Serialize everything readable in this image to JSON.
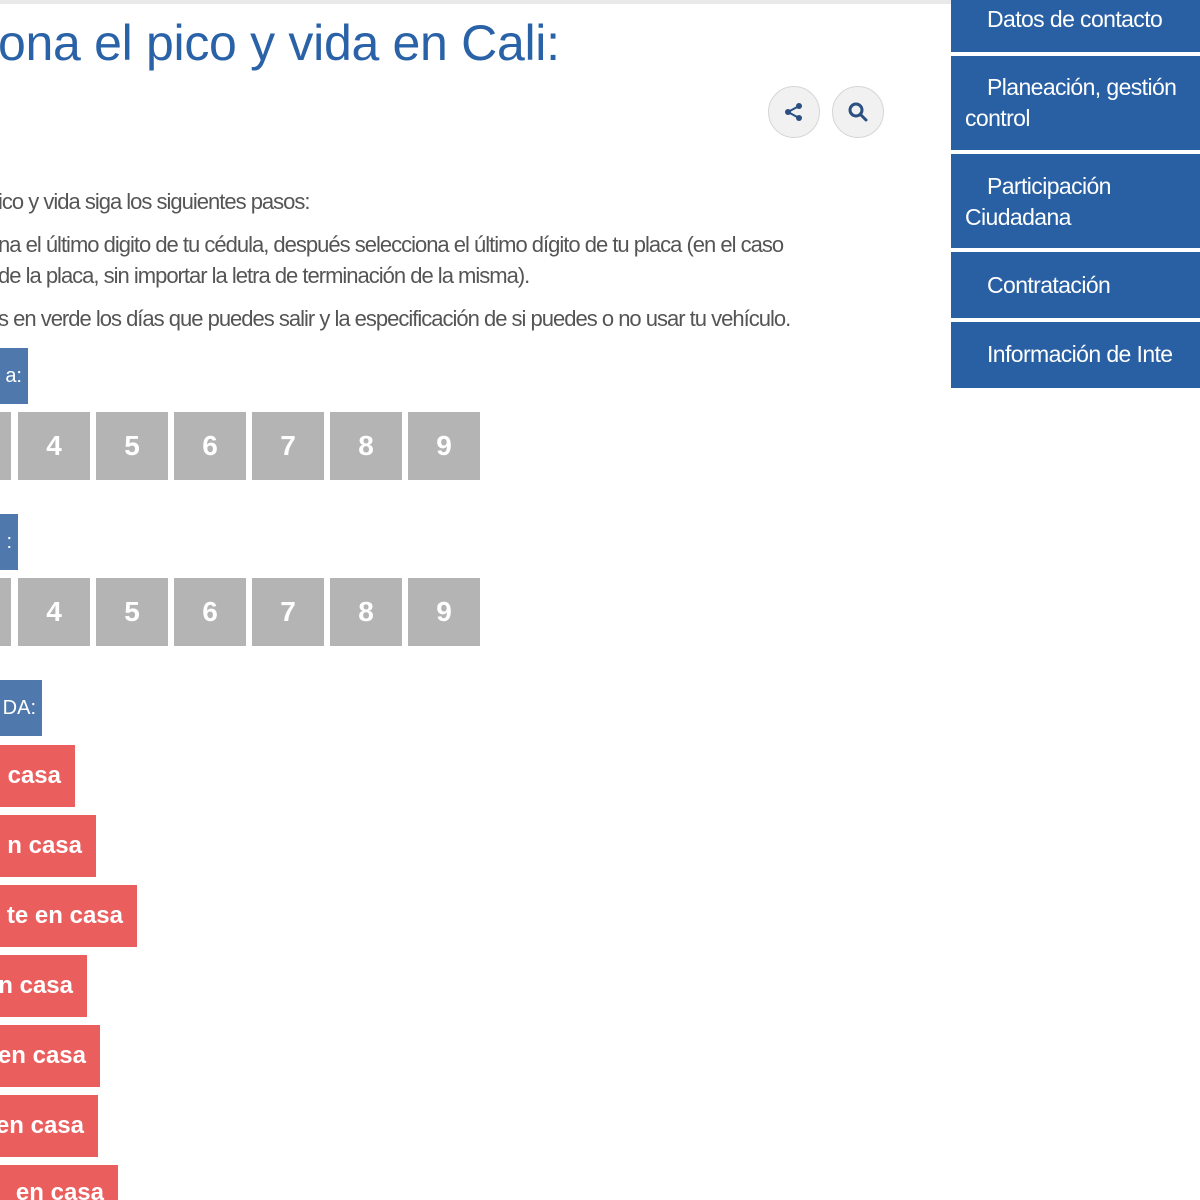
{
  "header": {
    "title": "ona el pico y vida en Cali:"
  },
  "toolbar": {
    "share_icon": "share-icon",
    "search_icon": "search-icon"
  },
  "content": {
    "intro": "ico y vida siga los siguientes pasos:",
    "step1_line1": "na el último digito de tu cédula, después selecciona el último dígito de tu placa (en el caso",
    "step1_line2": " de la placa, sin importar la letra de terminación de la misma).",
    "step2": "s en verde los días que puedes salir y la especificación de si puedes o no usar tu vehículo.",
    "cedula_label": "a:",
    "placa_label": ":",
    "result_label": "DA:"
  },
  "cedula_digits": [
    "",
    "4",
    "5",
    "6",
    "7",
    "8",
    "9"
  ],
  "placa_digits": [
    "",
    "4",
    "5",
    "6",
    "7",
    "8",
    "9"
  ],
  "results": [
    " casa",
    "n casa",
    "te en casa",
    "n casa",
    "en casa",
    "en casa",
    "en casa"
  ],
  "sidebar": {
    "items": [
      {
        "line1": "Datos de contacto",
        "line2": ""
      },
      {
        "line1": "Planeación, gestión",
        "line2": "control"
      },
      {
        "line1": "Participación",
        "line2": "Ciudadana"
      },
      {
        "line1": "Contratación",
        "line2": ""
      },
      {
        "line1": "Información de Inte",
        "line2": ""
      }
    ]
  },
  "colors": {
    "title": "#2a62a8",
    "sidebar_bg": "#2960a4",
    "label_bg": "#4f79ac",
    "digit_bg": "#b4b4b4",
    "result_bg": "#ea5e5e"
  }
}
